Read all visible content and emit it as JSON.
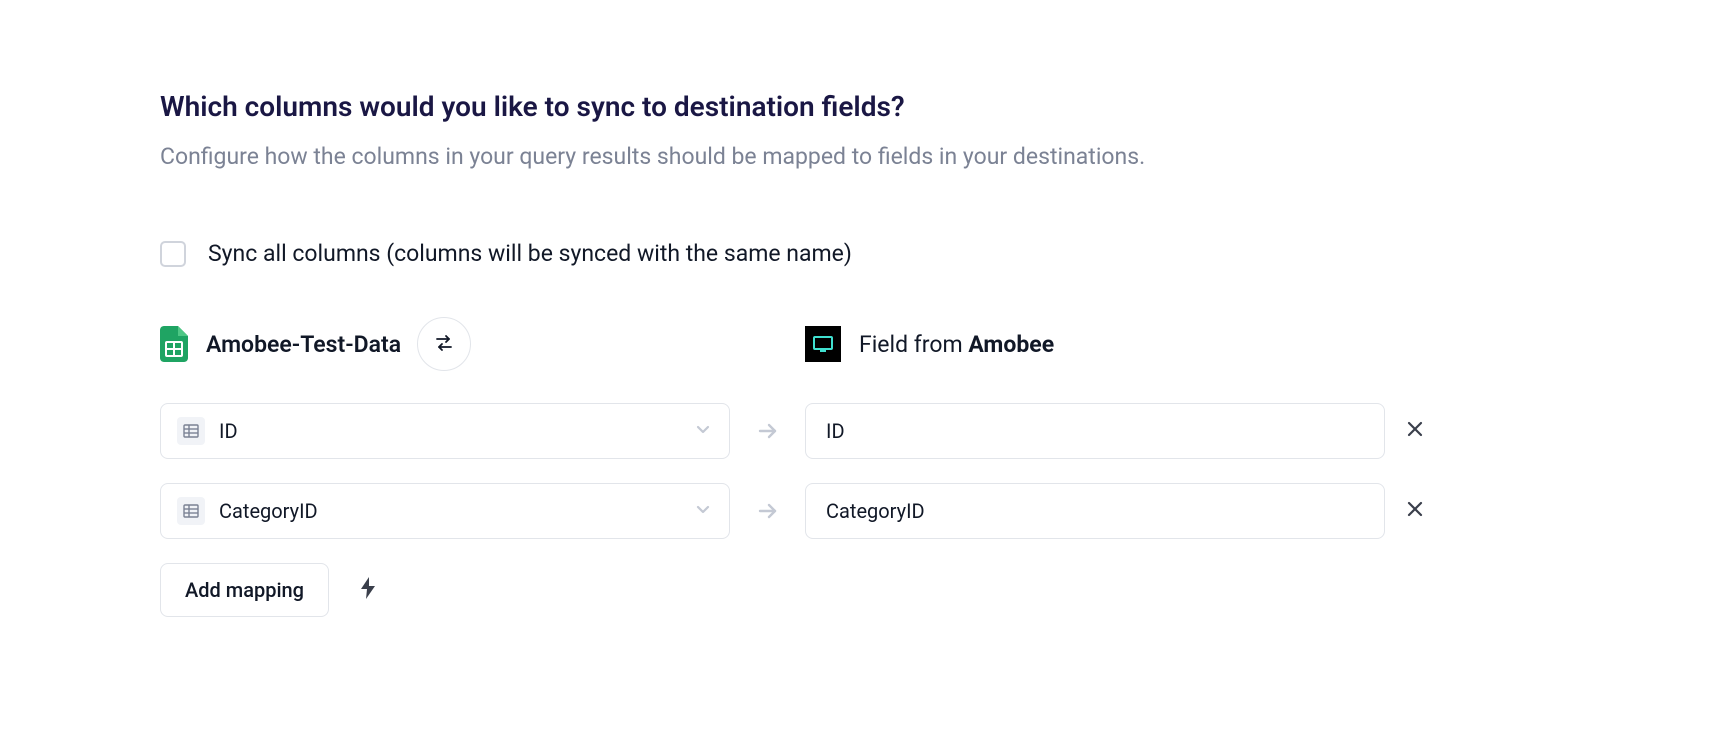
{
  "heading": "Which columns would you like to sync to destination fields?",
  "subheading": "Configure how the columns in your query results should be mapped to fields in your destinations.",
  "sync_all_label": "Sync all columns (columns will be synced with the same name)",
  "source": {
    "name": "Amobee-Test-Data",
    "icon": "google-sheets"
  },
  "destination": {
    "label_prefix": "Field from ",
    "name": "Amobee",
    "icon": "amobee"
  },
  "mappings": [
    {
      "source_column": "ID",
      "destination_field": "ID"
    },
    {
      "source_column": "CategoryID",
      "destination_field": "CategoryID"
    }
  ],
  "buttons": {
    "add_mapping": "Add mapping"
  }
}
